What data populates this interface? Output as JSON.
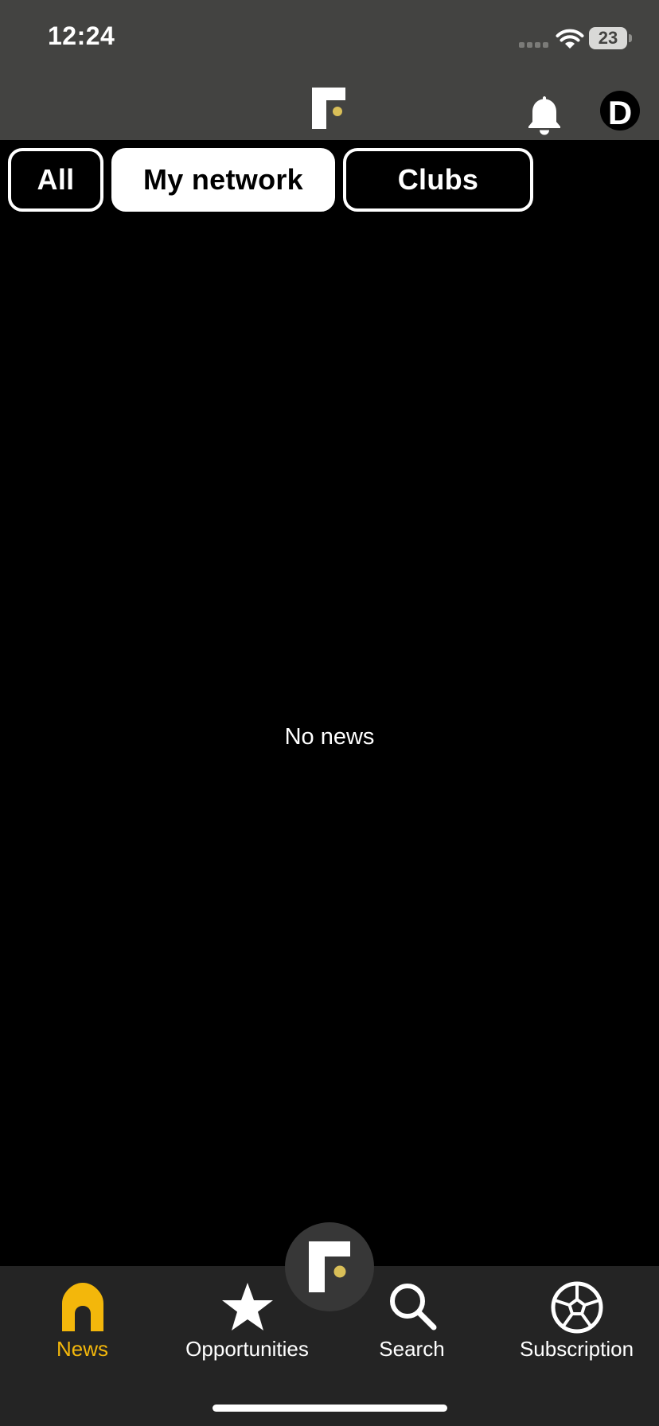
{
  "status_bar": {
    "time": "12:24",
    "battery": "23",
    "signal_icon": "cellular-signal-icon",
    "wifi_icon": "wifi-icon"
  },
  "header": {
    "logo_icon": "brand-logo-icon",
    "notification_icon": "bell-icon",
    "avatar_letter": "D"
  },
  "tabs": [
    {
      "label": "All",
      "active": false
    },
    {
      "label": "My network",
      "active": true
    },
    {
      "label": "Clubs",
      "active": false
    }
  ],
  "feed": {
    "empty_message": "No news"
  },
  "bottom_nav": {
    "items": [
      {
        "label": "News",
        "icon": "home-icon",
        "active": true
      },
      {
        "label": "Opportunities",
        "icon": "star-icon",
        "active": false
      },
      {
        "label": "Search",
        "icon": "search-icon",
        "active": false
      },
      {
        "label": "Subscription",
        "icon": "soccer-ball-icon",
        "active": false
      }
    ],
    "center_button_icon": "brand-logo-icon"
  },
  "colors": {
    "header_background": "#434341",
    "page_background": "#000000",
    "nav_background": "#242424",
    "accent": "#f3b70b",
    "logo_dot": "#d9bf58"
  }
}
